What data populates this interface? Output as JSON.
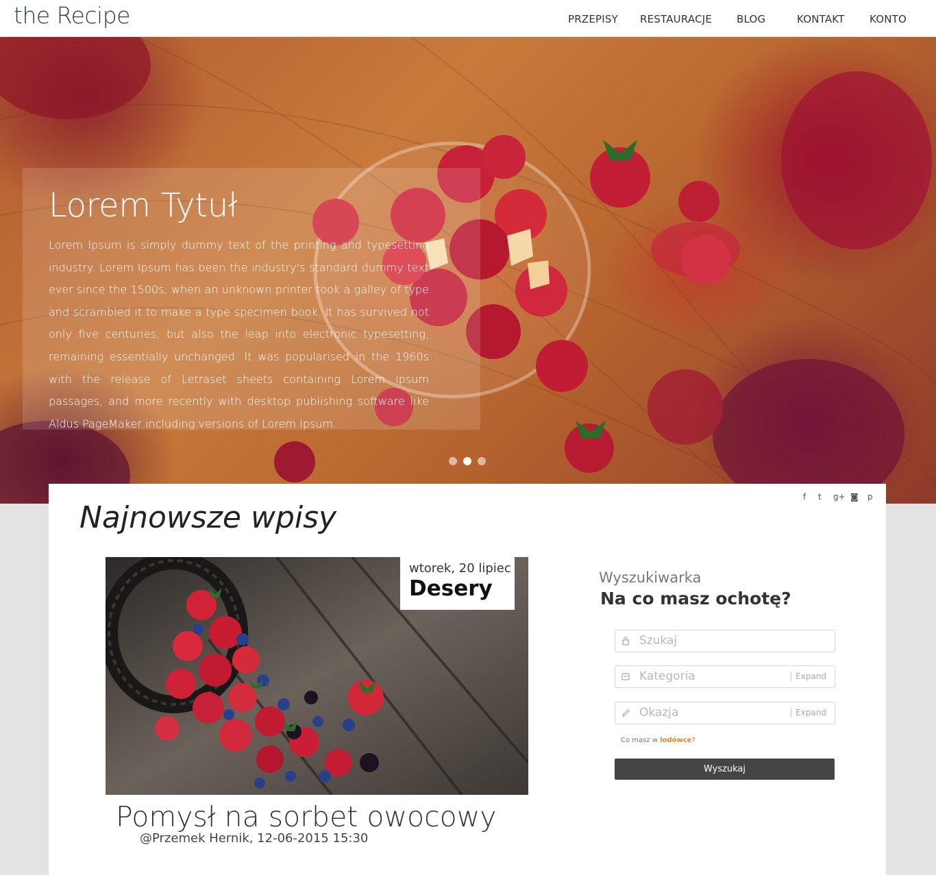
{
  "header": {
    "logo": "the Recipe",
    "nav": [
      "PRZEPISY",
      "RESTAURACJE",
      "BLOG",
      "KONTAKT",
      "KONTO"
    ]
  },
  "hero": {
    "title": "Lorem Tytuł",
    "text": "Lorem Ipsum is simply dummy text of the printing and typesetting industry. Lorem Ipsum has been the industry's standard dummy text ever since the 1500s, when an unknown printer took a galley of type and scrambled it to make a type specimen book. It has survived not only five centuries, but also the leap into electronic typesetting, remaining essentially unchanged. It was popularised in the 1960s with the release of Letraset sheets containing Lorem Ipsum passages, and more recently with desktop publishing software like Aldus PageMaker including versions of Lorem Ipsum.",
    "slides": 3,
    "active_slide": 2
  },
  "social": {
    "icons": [
      "facebook-icon",
      "twitter-icon",
      "google-plus-icon",
      "instagram-icon",
      "pinterest-icon"
    ],
    "glyphs": [
      "f",
      "t",
      "g+",
      "◙",
      "p"
    ]
  },
  "latest": {
    "title": "Najnowsze wpisy",
    "post": {
      "date": "wtorek, 20 lipiec",
      "category": "Desery",
      "title": "Pomysł na sorbet owocowy",
      "meta": "@Przemek Hernik, 12-06-2015 15:30"
    }
  },
  "search": {
    "subtitle": "Wyszukiwarka",
    "question": "Na co masz ochotę?",
    "query_placeholder": "Szukaj",
    "category_placeholder": "Kategoria",
    "occasion_placeholder": "Okazja",
    "expand_label": "Expand",
    "fridge_prefix": "Co masz w ",
    "fridge_link": "lodówce",
    "fridge_suffix": "?",
    "button": "Wyszukaj"
  },
  "colors": {
    "accent": "#e08a1e",
    "button": "#454545"
  }
}
